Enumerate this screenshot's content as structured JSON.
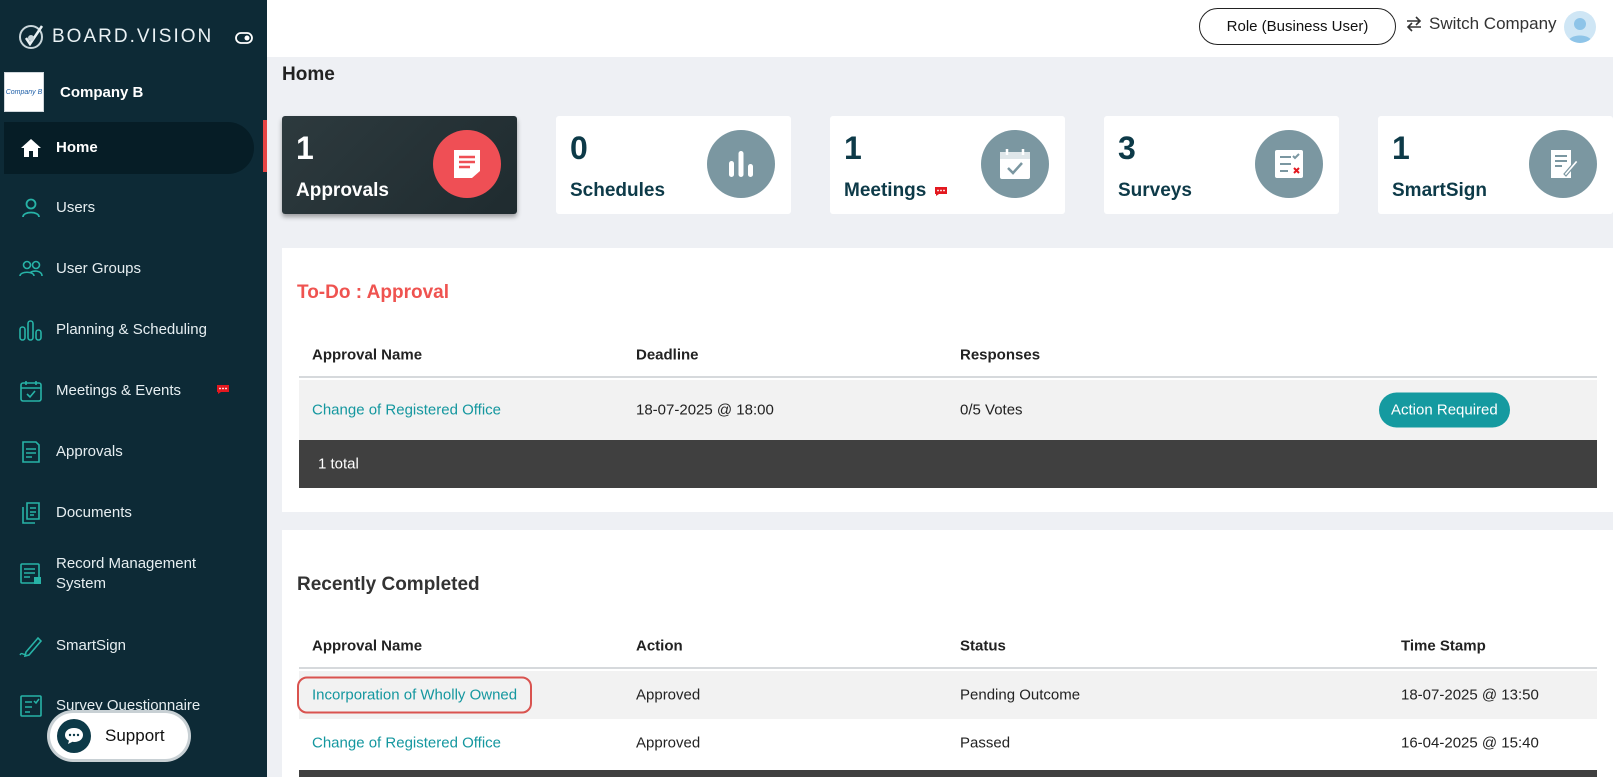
{
  "brand": {
    "name": "BOARD.VISION"
  },
  "company": {
    "name": "Company B",
    "logo_text": "Company B"
  },
  "sidebar": {
    "items": [
      {
        "label": "Home",
        "icon": "home-icon",
        "active": true
      },
      {
        "label": "Users",
        "icon": "user-icon"
      },
      {
        "label": "User Groups",
        "icon": "user-group-icon"
      },
      {
        "label": "Planning & Scheduling",
        "icon": "planning-icon"
      },
      {
        "label": "Meetings & Events",
        "icon": "calendar-icon",
        "badge": true
      },
      {
        "label": "Approvals",
        "icon": "approval-doc-icon"
      },
      {
        "label": "Documents",
        "icon": "documents-icon"
      },
      {
        "label": "Record Management System",
        "icon": "record-icon"
      },
      {
        "label": "SmartSign",
        "icon": "pen-icon"
      },
      {
        "label": "Survey Questionnaire",
        "icon": "survey-icon"
      }
    ]
  },
  "support": {
    "label": "Support"
  },
  "topbar": {
    "role_label": "Role (Business User)",
    "switch_label": "Switch Company"
  },
  "page": {
    "title": "Home"
  },
  "cards": [
    {
      "count": "1",
      "label": "Approvals",
      "icon": "approval-icon",
      "active": true
    },
    {
      "count": "0",
      "label": "Schedules",
      "icon": "bar-chart-icon"
    },
    {
      "count": "1",
      "label": "Meetings",
      "icon": "calendar-check-icon",
      "badge": true
    },
    {
      "count": "3",
      "label": "Surveys",
      "icon": "survey-check-icon"
    },
    {
      "count": "1",
      "label": "SmartSign",
      "icon": "sign-doc-icon"
    }
  ],
  "todo": {
    "title": "To-Do : Approval",
    "headers": {
      "name": "Approval Name",
      "deadline": "Deadline",
      "responses": "Responses"
    },
    "rows": [
      {
        "name": "Change of Registered Office",
        "deadline": "18-07-2025 @ 18:00",
        "responses": "0/5 Votes",
        "action": "Action Required"
      }
    ],
    "total": "1 total"
  },
  "recent": {
    "title": "Recently Completed",
    "headers": {
      "name": "Approval Name",
      "action": "Action",
      "status": "Status",
      "timestamp": "Time Stamp"
    },
    "rows": [
      {
        "name": "Incorporation of Wholly Owned",
        "action": "Approved",
        "status": "Pending Outcome",
        "timestamp": "18-07-2025 @ 13:50"
      },
      {
        "name": "Change of Registered Office",
        "action": "Approved",
        "status": "Passed",
        "timestamp": "16-04-2025 @ 15:40"
      }
    ]
  },
  "colors": {
    "sidebar_bg": "#0d2a36",
    "accent_teal": "#159aa0",
    "accent_red": "#ef4f55",
    "card_icon_bg": "#7b97a1"
  }
}
